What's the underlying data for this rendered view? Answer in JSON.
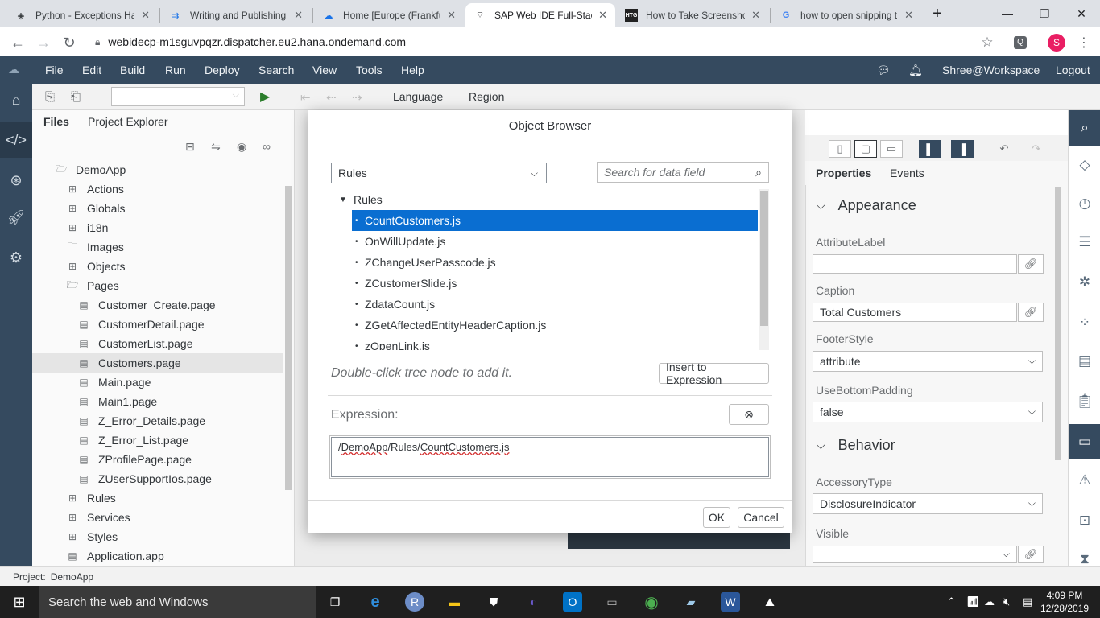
{
  "browser": {
    "tabs": [
      {
        "title": "Python - Exceptions Ha",
        "icon": "python-icon",
        "active": false
      },
      {
        "title": "Writing and Publishing",
        "icon": "sap-icon",
        "active": false
      },
      {
        "title": "Home [Europe (Frankfu",
        "icon": "cloud-icon",
        "active": false
      },
      {
        "title": "SAP Web IDE Full-Stack",
        "icon": "webide-icon",
        "active": true
      },
      {
        "title": "How to Take Screensho",
        "icon": "htg-icon",
        "active": false
      },
      {
        "title": "how to open snipping t",
        "icon": "google-icon",
        "active": false
      }
    ],
    "htg_label": "HTG",
    "url": "webidecp-m1sguvpqzr.dispatcher.eu2.hana.ondemand.com",
    "profile_initial": "S"
  },
  "shell": {
    "menu": [
      "File",
      "Edit",
      "Build",
      "Run",
      "Deploy",
      "Search",
      "View",
      "Tools",
      "Help"
    ],
    "user": "Shree@Workspace",
    "logout": "Logout"
  },
  "toolbar": {
    "language": "Language",
    "region": "Region"
  },
  "leftpanel": {
    "tabs": [
      "Files",
      "Project Explorer"
    ],
    "tree": [
      {
        "label": "DemoApp",
        "icon": "folder-open-icon",
        "indent": 0
      },
      {
        "label": "Actions",
        "icon": "folder-plus-icon",
        "indent": 1
      },
      {
        "label": "Globals",
        "icon": "folder-plus-icon",
        "indent": 1
      },
      {
        "label": "i18n",
        "icon": "folder-plus-icon",
        "indent": 1
      },
      {
        "label": "Images",
        "icon": "folder-icon",
        "indent": 1
      },
      {
        "label": "Objects",
        "icon": "folder-plus-icon",
        "indent": 1
      },
      {
        "label": "Pages",
        "icon": "folder-open-icon",
        "indent": 1
      },
      {
        "label": "Customer_Create.page",
        "icon": "file-icon",
        "indent": 2
      },
      {
        "label": "CustomerDetail.page",
        "icon": "file-icon",
        "indent": 2
      },
      {
        "label": "CustomerList.page",
        "icon": "file-icon",
        "indent": 2
      },
      {
        "label": "Customers.page",
        "icon": "file-icon",
        "indent": 2,
        "selected": true
      },
      {
        "label": "Main.page",
        "icon": "file-icon",
        "indent": 2
      },
      {
        "label": "Main1.page",
        "icon": "file-icon",
        "indent": 2
      },
      {
        "label": "Z_Error_Details.page",
        "icon": "file-icon",
        "indent": 2
      },
      {
        "label": "Z_Error_List.page",
        "icon": "file-icon",
        "indent": 2
      },
      {
        "label": "ZProfilePage.page",
        "icon": "file-icon",
        "indent": 2
      },
      {
        "label": "ZUserSupportIos.page",
        "icon": "file-icon",
        "indent": 2
      },
      {
        "label": "Rules",
        "icon": "folder-plus-icon",
        "indent": 1
      },
      {
        "label": "Services",
        "icon": "folder-plus-icon",
        "indent": 1
      },
      {
        "label": "Styles",
        "icon": "folder-plus-icon",
        "indent": 1
      },
      {
        "label": "Application.app",
        "icon": "file-icon",
        "indent": 1
      }
    ]
  },
  "properties": {
    "tabs": [
      "Properties",
      "Events"
    ],
    "appearance_header": "Appearance",
    "behavior_header": "Behavior",
    "fields": {
      "attribute_label": {
        "label": "AttributeLabel",
        "value": ""
      },
      "caption": {
        "label": "Caption",
        "value": "Total Customers"
      },
      "footer_style": {
        "label": "FooterStyle",
        "value": "attribute"
      },
      "use_bottom_padding": {
        "label": "UseBottomPadding",
        "value": "false"
      },
      "accessory_type": {
        "label": "AccessoryType",
        "value": "DisclosureIndicator"
      },
      "visible": {
        "label": "Visible",
        "value": ""
      }
    }
  },
  "dialog": {
    "title": "Object Browser",
    "category_select": "Rules",
    "search_placeholder": "Search for data field",
    "tree_root": "Rules",
    "items": [
      {
        "label": "CountCustomers.js",
        "selected": true
      },
      {
        "label": "OnWillUpdate.js",
        "selected": false
      },
      {
        "label": "ZChangeUserPasscode.js",
        "selected": false
      },
      {
        "label": "ZCustomerSlide.js",
        "selected": false
      },
      {
        "label": "ZdataCount.js",
        "selected": false
      },
      {
        "label": "ZGetAffectedEntityHeaderCaption.js",
        "selected": false
      },
      {
        "label": "zOpenLink.js",
        "selected": false
      }
    ],
    "hint": "Double-click tree node to add it.",
    "insert_button": "Insert to Expression",
    "expression_label": "Expression:",
    "expression_parts": [
      "/",
      "DemoApp",
      "/Rules/",
      "CountCustomers.js"
    ],
    "ok": "OK",
    "cancel": "Cancel"
  },
  "status": {
    "label": "Project:",
    "value": "DemoApp"
  },
  "taskbar": {
    "search": "Search the web and Windows",
    "time": "4:09 PM",
    "date": "12/28/2019"
  },
  "colors": {
    "shell": "#354a5f",
    "selection": "#0a6ed1"
  }
}
